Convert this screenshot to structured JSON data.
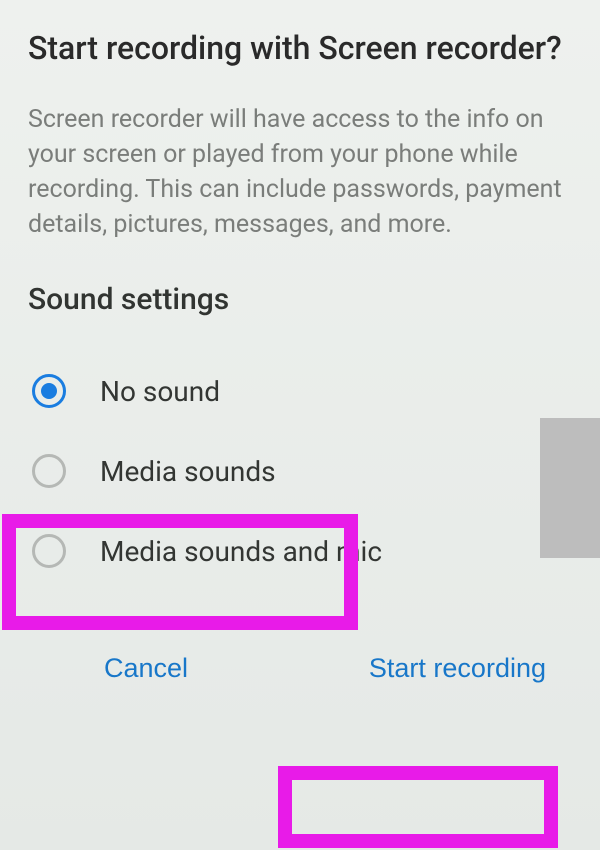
{
  "dialog": {
    "title": "Start recording with Screen recorder?",
    "description": "Screen recorder will have access to the info on your screen or played from your phone while recording. This can include passwords, payment details, pictures, messages, and more.",
    "section_header": "Sound settings",
    "options": {
      "no_sound": "No sound",
      "media_sounds": "Media sounds",
      "media_mic": "Media sounds and mic"
    },
    "selected": "no_sound",
    "buttons": {
      "cancel": "Cancel",
      "start": "Start recording"
    }
  }
}
